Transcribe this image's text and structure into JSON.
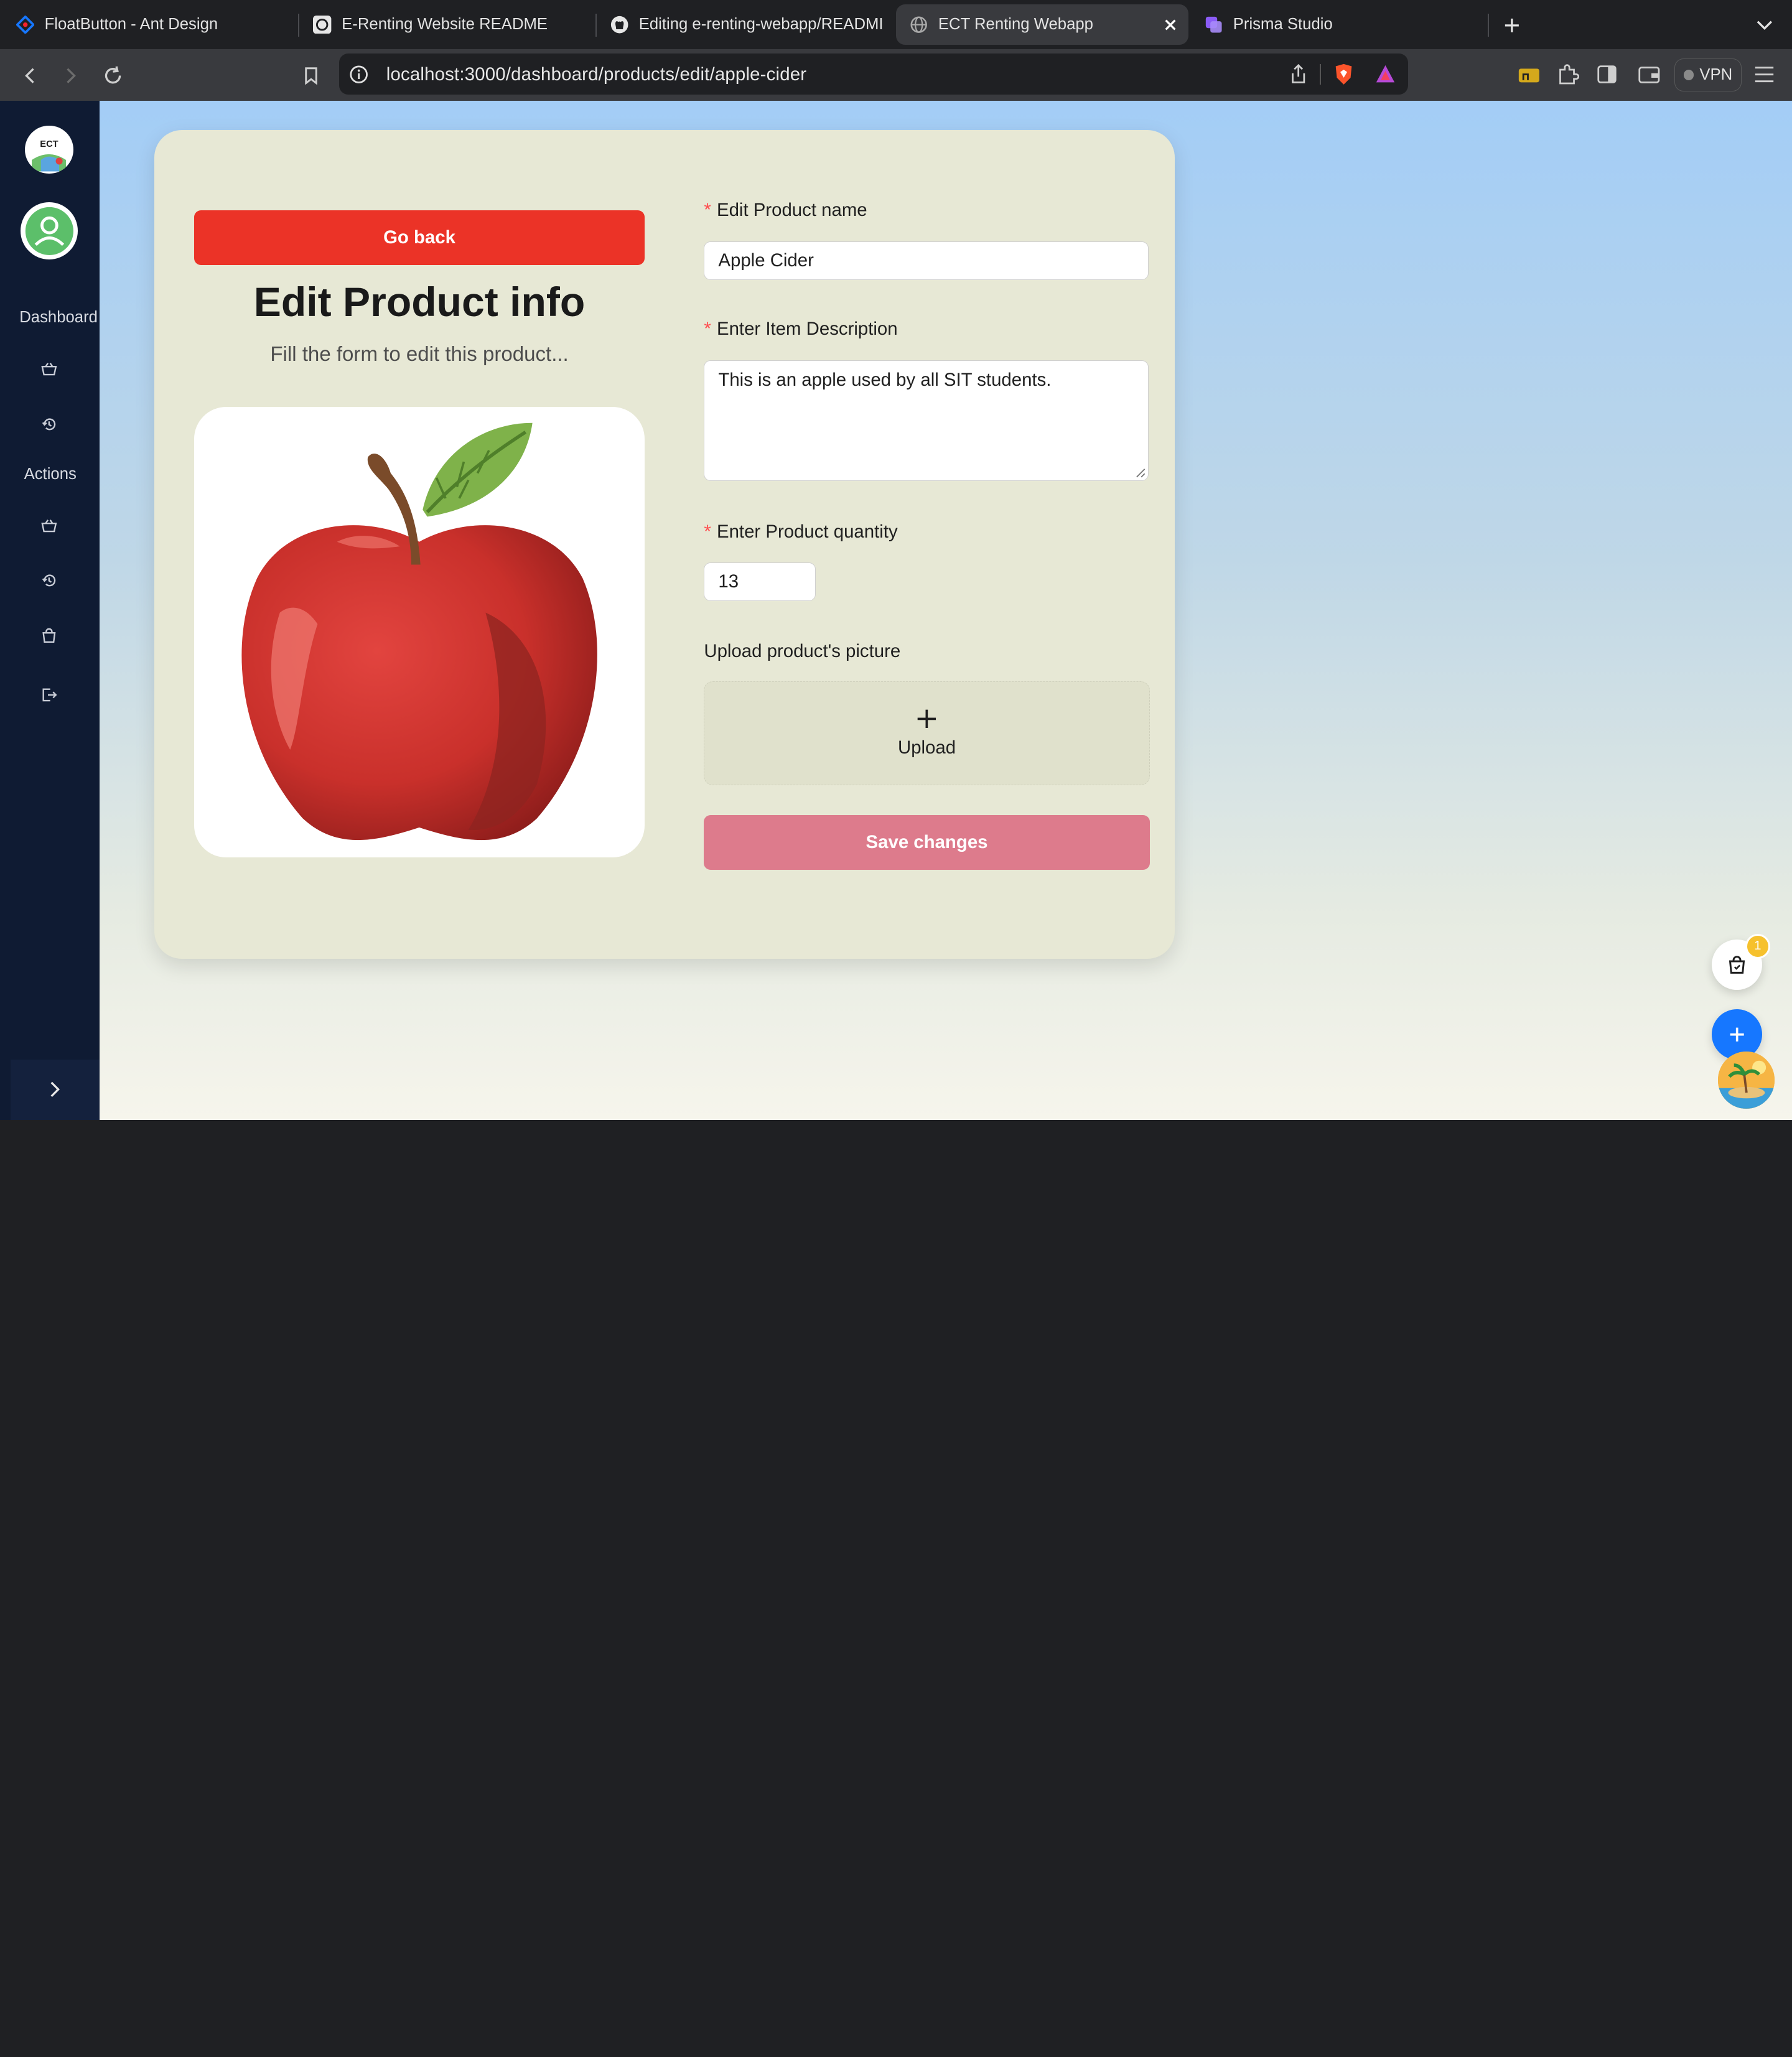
{
  "browser": {
    "tabs": [
      {
        "title": "FloatButton - Ant Design",
        "icon": "ant-design-icon"
      },
      {
        "title": "E-Renting Website README",
        "icon": "chatgpt-icon"
      },
      {
        "title": "Editing e-renting-webapp/READMI",
        "icon": "github-icon"
      },
      {
        "title": "ECT Renting Webapp",
        "icon": "globe-icon",
        "active": true
      },
      {
        "title": "Prisma Studio",
        "icon": "prisma-icon"
      }
    ],
    "url": "localhost:3000/dashboard/products/edit/apple-cider",
    "vpn_label": "VPN"
  },
  "sidebar": {
    "logo_text": "ECT",
    "dashboard_label": "Dashboard",
    "actions_label": "Actions",
    "icons": [
      "basket-icon",
      "history-icon",
      "basket-icon",
      "history-icon",
      "shopping-bag-icon",
      "logout-icon"
    ],
    "collapse_icon": "chevron-right-icon"
  },
  "form": {
    "go_back_label": "Go back",
    "title": "Edit Product info",
    "subtitle": "Fill the form to edit this product...",
    "product_image": "apple-illustration",
    "name_label": "Edit Product name",
    "name_value": "Apple Cider",
    "description_label": "Enter Item Description",
    "description_value": "This is an apple used by all SIT students.",
    "quantity_label": "Enter Product quantity",
    "quantity_value": "13",
    "upload_section_label": "Upload product's picture",
    "upload_label": "Upload",
    "save_label": "Save changes",
    "required_mark": "*"
  },
  "float_buttons": {
    "cart_badge": "1"
  },
  "colors": {
    "go_back": "#eb3327",
    "save": "#dd7b8c",
    "sidebar": "#0f1b33",
    "card": "#e7e8d5",
    "float_add": "#1677ff",
    "badge": "#f6c12d"
  }
}
